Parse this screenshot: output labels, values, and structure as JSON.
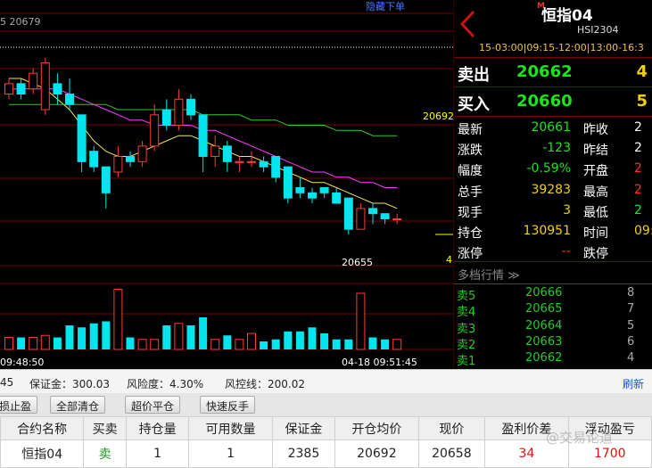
{
  "chart_panel": {
    "hide_order_link": "隐藏下单",
    "top_left_label": "5 20679",
    "high_marker": "20692",
    "low_marker": "20655",
    "right_edge_value": "4",
    "time_start": "09:48:50",
    "time_end": "04-18 09:51:45"
  },
  "chart_data": {
    "type": "candlestick",
    "price_ylim": [
      20650,
      20698
    ],
    "reference_line": 20692,
    "candles": [
      {
        "o": 20683,
        "h": 20686,
        "l": 20682,
        "c": 20685
      },
      {
        "o": 20685,
        "h": 20686,
        "l": 20682,
        "c": 20683
      },
      {
        "o": 20684,
        "h": 20688,
        "l": 20683,
        "c": 20687
      },
      {
        "o": 20680,
        "h": 20690,
        "l": 20679,
        "c": 20689
      },
      {
        "o": 20685,
        "h": 20687,
        "l": 20681,
        "c": 20683
      },
      {
        "o": 20683,
        "h": 20686,
        "l": 20680,
        "c": 20681
      },
      {
        "o": 20679,
        "h": 20679,
        "l": 20668,
        "c": 20670
      },
      {
        "o": 20672,
        "h": 20673,
        "l": 20668,
        "c": 20669
      },
      {
        "o": 20669,
        "h": 20669,
        "l": 20661,
        "c": 20664
      },
      {
        "o": 20668,
        "h": 20673,
        "l": 20667,
        "c": 20671
      },
      {
        "o": 20671,
        "h": 20672,
        "l": 20669,
        "c": 20670
      },
      {
        "o": 20670,
        "h": 20674,
        "l": 20669,
        "c": 20673
      },
      {
        "o": 20673,
        "h": 20681,
        "l": 20672,
        "c": 20679
      },
      {
        "o": 20680,
        "h": 20682,
        "l": 20676,
        "c": 20677
      },
      {
        "o": 20677,
        "h": 20684,
        "l": 20676,
        "c": 20682
      },
      {
        "o": 20682,
        "h": 20683,
        "l": 20678,
        "c": 20679
      },
      {
        "o": 20679,
        "h": 20679,
        "l": 20668,
        "c": 20671
      },
      {
        "o": 20671,
        "h": 20675,
        "l": 20669,
        "c": 20673
      },
      {
        "o": 20673,
        "h": 20674,
        "l": 20668,
        "c": 20670
      },
      {
        "o": 20670,
        "h": 20671,
        "l": 20668,
        "c": 20670
      },
      {
        "o": 20670,
        "h": 20672,
        "l": 20669,
        "c": 20670
      },
      {
        "o": 20670,
        "h": 20671,
        "l": 20668,
        "c": 20669
      },
      {
        "o": 20671,
        "h": 20671,
        "l": 20666,
        "c": 20667
      },
      {
        "o": 20669,
        "h": 20669,
        "l": 20662,
        "c": 20663
      },
      {
        "o": 20665,
        "h": 20667,
        "l": 20663,
        "c": 20664
      },
      {
        "o": 20664,
        "h": 20665,
        "l": 20662,
        "c": 20663
      },
      {
        "o": 20665,
        "h": 20665,
        "l": 20663,
        "c": 20664
      },
      {
        "o": 20664,
        "h": 20665,
        "l": 20662,
        "c": 20662
      },
      {
        "o": 20663,
        "h": 20663,
        "l": 20656,
        "c": 20657
      },
      {
        "o": 20657,
        "h": 20662,
        "l": 20657,
        "c": 20661
      },
      {
        "o": 20661,
        "h": 20662,
        "l": 20658,
        "c": 20660
      },
      {
        "o": 20660,
        "h": 20660,
        "l": 20658,
        "c": 20659
      },
      {
        "o": 20659,
        "h": 20660,
        "l": 20658,
        "c": 20659
      }
    ],
    "ma_lines": [
      {
        "color": "#f5e65a",
        "values": [
          20686,
          20686,
          20685,
          20684,
          20682,
          20680,
          20677,
          20674,
          20672,
          20671,
          20671,
          20672,
          20673,
          20674,
          20675,
          20675,
          20674,
          20673,
          20672,
          20671,
          20671,
          20670,
          20669,
          20668,
          20667,
          20666,
          20666,
          20665,
          20664,
          20663,
          20662,
          20662,
          20661
        ]
      },
      {
        "color": "#ff3bff",
        "values": [
          20684,
          20684,
          20684,
          20684,
          20684,
          20683,
          20682,
          20681,
          20680,
          20679,
          20678,
          20678,
          20677,
          20677,
          20677,
          20677,
          20676,
          20676,
          20675,
          20674,
          20673,
          20672,
          20671,
          20670,
          20669,
          20668,
          20668,
          20667,
          20667,
          20666,
          20666,
          20665,
          20665
        ]
      },
      {
        "color": "#2ecc2e",
        "values": [
          20681,
          20681,
          20681,
          20681,
          20681,
          20681,
          20681,
          20681,
          20681,
          20680,
          20680,
          20680,
          20680,
          20680,
          20680,
          20680,
          20679,
          20679,
          20679,
          20679,
          20678,
          20678,
          20678,
          20677,
          20677,
          20677,
          20677,
          20676,
          20676,
          20676,
          20675,
          20675,
          20675
        ]
      }
    ],
    "volumes": [
      6,
      6,
      6,
      7,
      6,
      12,
      11,
      13,
      14,
      30,
      6,
      5,
      5,
      12,
      13,
      12,
      16,
      5,
      7,
      5,
      8,
      4,
      5,
      9,
      9,
      11,
      8,
      5,
      5,
      28,
      6,
      5,
      5
    ],
    "volume_ylim": [
      0,
      32
    ]
  },
  "quote": {
    "title_prefix": "M",
    "title": "恒指04",
    "code": "HSI2304",
    "session": "15-03:00|09:15-12:00|13:00-16:3",
    "sell": {
      "label": "卖出",
      "price": "20662",
      "volume": "4"
    },
    "buy": {
      "label": "买入",
      "price": "20660",
      "volume": "5"
    },
    "stats": [
      {
        "label": "最新",
        "value": "20661",
        "value_color": "#19e619",
        "label2": "昨收",
        "value2": "2",
        "value2_color": "#ffffff"
      },
      {
        "label": "涨跌",
        "value": "-123",
        "value_color": "#19e619",
        "label2": "昨结",
        "value2": "2",
        "value2_color": "#ffffff"
      },
      {
        "label": "幅度",
        "value": "-0.59%",
        "value_color": "#19e619",
        "label2": "开盘",
        "value2": "2",
        "value2_color": "#ff3030"
      },
      {
        "label": "总手",
        "value": "39283",
        "value_color": "#f0d000",
        "label2": "最高",
        "value2": "2",
        "value2_color": "#ff3030"
      },
      {
        "label": "现手",
        "value": "3",
        "value_color": "#f0d000",
        "label2": "最低",
        "value2": "2",
        "value2_color": "#19e619"
      },
      {
        "label": "持仓",
        "value": "130951",
        "value_color": "#f0d000",
        "label2": "时间",
        "value2": "09:",
        "value2_color": "#f0d000"
      },
      {
        "label": "涨停",
        "value": "--",
        "value_color": "#ff3030",
        "label2": "跌停",
        "value2": "",
        "value2_color": "#19e619"
      }
    ],
    "depth_title": "多档行情 ≫",
    "depth": [
      {
        "label": "卖5",
        "price": "20666",
        "volume": "8"
      },
      {
        "label": "卖4",
        "price": "20665",
        "volume": "7"
      },
      {
        "label": "卖3",
        "price": "20664",
        "volume": "5"
      },
      {
        "label": "卖2",
        "price": "20663",
        "volume": "6"
      },
      {
        "label": "卖1",
        "price": "20662",
        "volume": "4"
      }
    ]
  },
  "info_bar": {
    "left_value": "45",
    "margin": "保证金：300.03",
    "risk": "风险度：4.30%",
    "risk_control": "风控线：200.02",
    "refresh": "刷新"
  },
  "buttons": {
    "stop_loss": "损止盈",
    "close_all": "全部清仓",
    "super_close": "超价平仓",
    "quick_reverse": "快速反手"
  },
  "positions": {
    "headers": [
      "合约名称",
      "买卖",
      "持仓量",
      "可用数量",
      "保证金",
      "开仓均价",
      "现价",
      "盈利价差",
      "浮动盈亏"
    ],
    "rows": [
      [
        "恒指04",
        "卖",
        "1",
        "1",
        "2385",
        "20692",
        "20658",
        "34",
        "1700"
      ]
    ]
  },
  "watermark": "@交易论道"
}
